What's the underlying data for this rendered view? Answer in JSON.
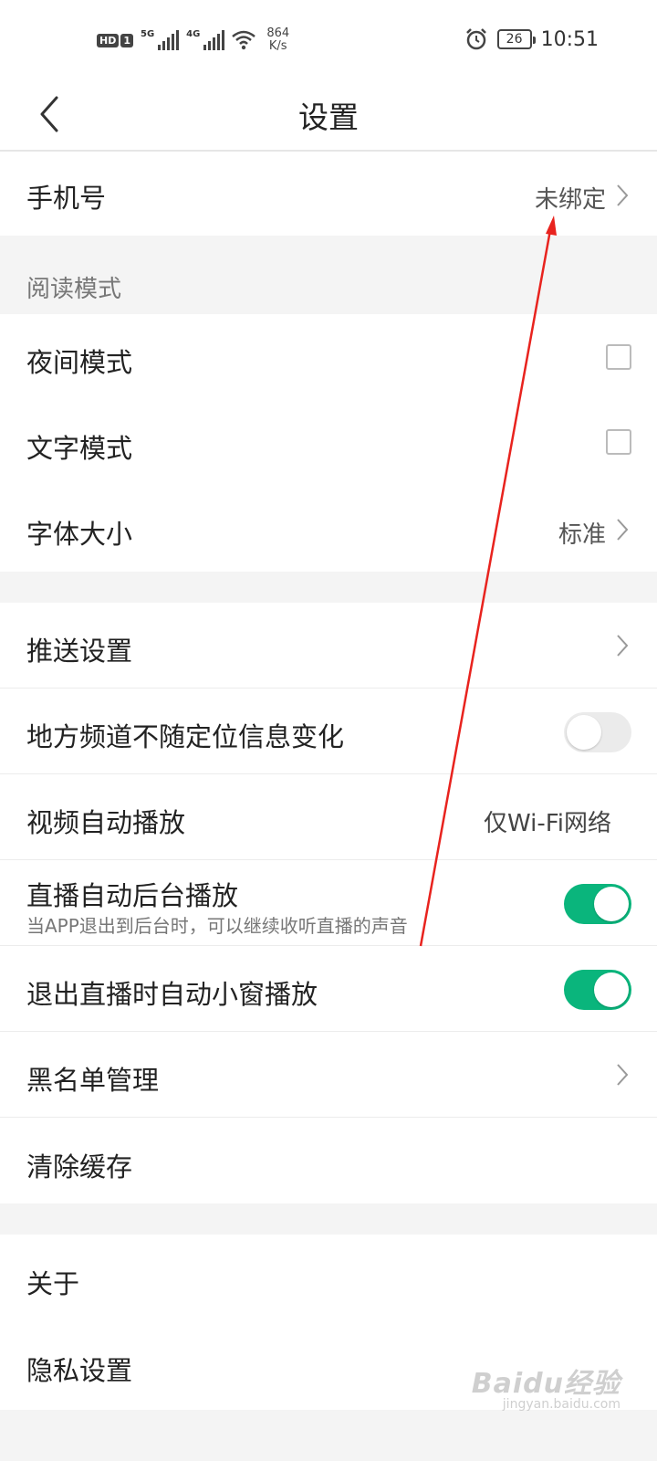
{
  "status_bar": {
    "hd_label": "HD",
    "sim_label": "1",
    "signal1_gen": "5G",
    "signal2_gen": "4G",
    "net_speed_value": "864",
    "net_speed_unit": "K/s",
    "battery": "26",
    "time": "10:51"
  },
  "nav": {
    "title": "设置"
  },
  "rows": {
    "phone": {
      "label": "手机号",
      "value": "未绑定"
    },
    "reading_mode_header": "阅读模式",
    "night_mode": {
      "label": "夜间模式",
      "checked": false
    },
    "text_mode": {
      "label": "文字模式",
      "checked": false
    },
    "font_size": {
      "label": "字体大小",
      "value": "标准"
    },
    "push_settings": {
      "label": "推送设置"
    },
    "local_channel": {
      "label": "地方频道不随定位信息变化",
      "on": false
    },
    "video_autoplay": {
      "label": "视频自动播放",
      "value": "仅Wi-Fi网络"
    },
    "live_background": {
      "label": "直播自动后台播放",
      "sub": "当APP退出到后台时，可以继续收听直播的声音",
      "on": true
    },
    "live_pip": {
      "label": "退出直播时自动小窗播放",
      "on": true
    },
    "blacklist": {
      "label": "黑名单管理"
    },
    "clear_cache": {
      "label": "清除缓存"
    },
    "about": {
      "label": "关于"
    },
    "privacy": {
      "label": "隐私设置"
    }
  },
  "colors": {
    "toggle_on": "#0ab57c",
    "toggle_off": "#ebebeb",
    "annotation_arrow": "#e8231e"
  },
  "watermark": {
    "main": "Baidu经验",
    "sub": "jingyan.baidu.com"
  }
}
